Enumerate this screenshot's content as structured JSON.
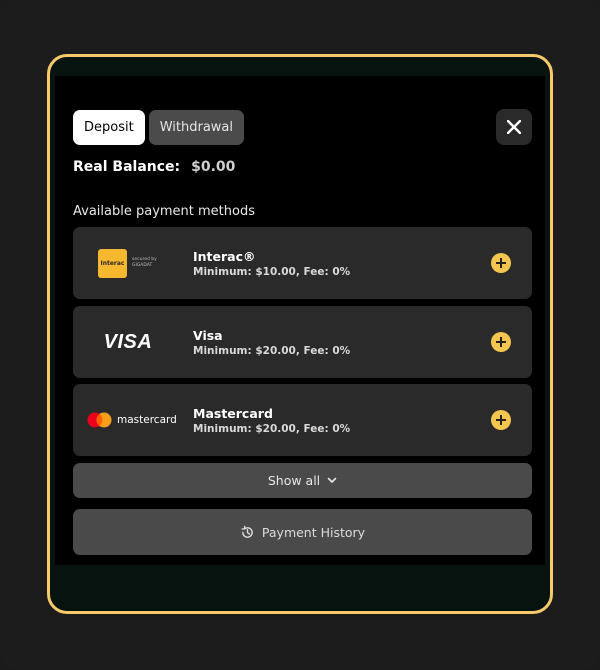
{
  "tabs": {
    "deposit": "Deposit",
    "withdrawal": "Withdrawal"
  },
  "balance": {
    "label": "Real Balance:",
    "value": "$0.00"
  },
  "section_title": "Available payment methods",
  "methods": [
    {
      "name": "Interac®",
      "limits": "Minimum: $10.00, Fee: 0%",
      "logo_text": "Interac",
      "logo_sub": "secured by GIGADAT"
    },
    {
      "name": "Visa",
      "limits": "Minimum: $20.00, Fee: 0%",
      "logo_text": "VISA"
    },
    {
      "name": "Mastercard",
      "limits": "Minimum: $20.00, Fee: 0%",
      "logo_text": "mastercard"
    }
  ],
  "show_all": "Show all",
  "history": "Payment History",
  "colors": {
    "accent": "#f6c96b",
    "plus": "#f5c64f",
    "card": "#2a2a2a"
  },
  "icons": {
    "close": "close-icon",
    "add": "plus-icon",
    "chevron": "chevron-down-icon",
    "history": "history-icon"
  }
}
